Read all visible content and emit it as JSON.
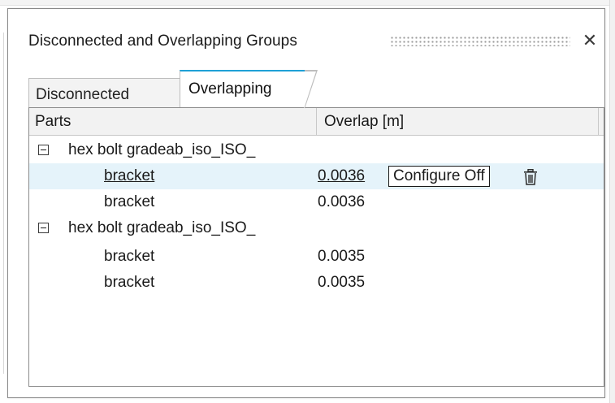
{
  "dialog": {
    "title": "Disconnected and Overlapping Groups",
    "close_symbol": "✕"
  },
  "tabs": [
    {
      "label": "Disconnected",
      "active": false
    },
    {
      "label": "Overlapping",
      "active": true
    }
  ],
  "table": {
    "columns": [
      "Parts",
      "Overlap [m]"
    ],
    "groups": [
      {
        "label": "hex bolt gradeab_iso_ISO_",
        "expanded": true,
        "children": [
          {
            "part": "bracket",
            "overlap": "0.0036",
            "selected": true
          },
          {
            "part": "bracket",
            "overlap": "0.0036",
            "selected": false
          }
        ]
      },
      {
        "label": "hex bolt gradeab_iso_ISO_",
        "expanded": true,
        "children": [
          {
            "part": "bracket",
            "overlap": "0.0035",
            "selected": false
          },
          {
            "part": "bracket",
            "overlap": "0.0035",
            "selected": false
          }
        ]
      }
    ],
    "row_actions": {
      "configure_label": "Configure Off",
      "delete_icon": "trash-icon"
    }
  },
  "colors": {
    "active_tab_accent": "#1ea0d6",
    "selected_row": "#e5f3fa",
    "header_bg": "#f2f2f2"
  }
}
